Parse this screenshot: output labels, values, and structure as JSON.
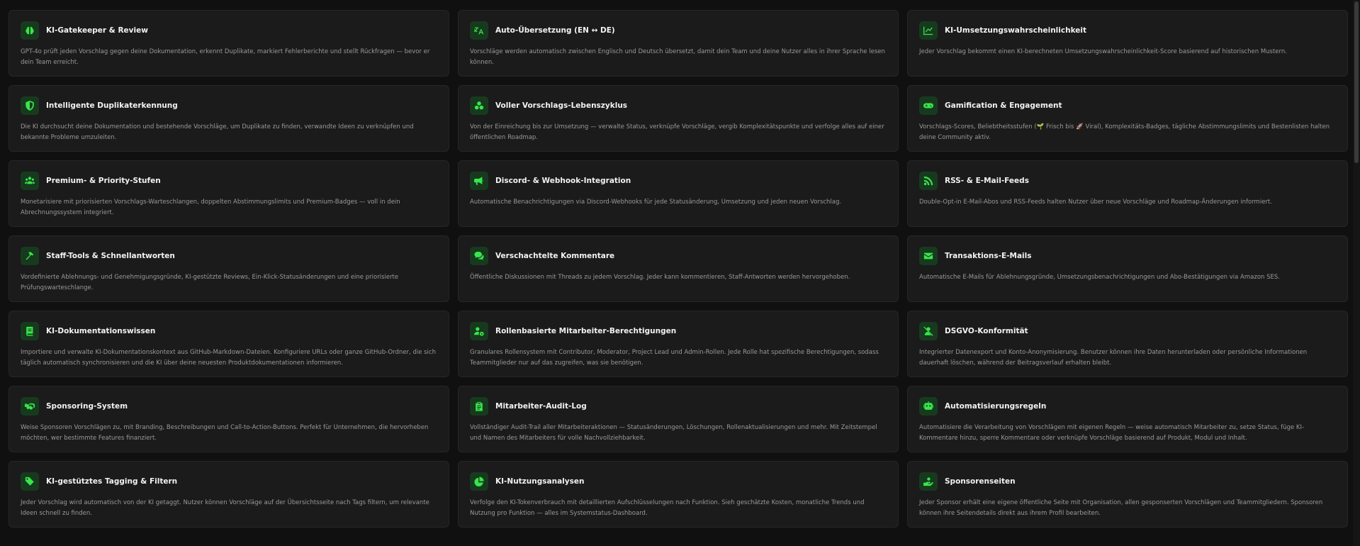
{
  "accent_color": "#38e64a",
  "cards": [
    {
      "icon": "brain-icon",
      "title": "KI-Gatekeeper & Review",
      "desc": "GPT-4o prüft jeden Vorschlag gegen deine Dokumentation, erkennt Duplikate, markiert Fehlerberichte und stellt Rückfragen — bevor er dein Team erreicht."
    },
    {
      "icon": "translate-icon",
      "title": "Auto-Übersetzung (EN ↔ DE)",
      "desc": "Vorschläge werden automatisch zwischen Englisch und Deutsch übersetzt, damit dein Team und deine Nutzer alles in ihrer Sprache lesen können."
    },
    {
      "icon": "trend-chart-icon",
      "title": "KI-Umsetzungswahrscheinlichkeit",
      "desc": "Jeder Vorschlag bekommt einen KI-berechneten Umsetzungswahrscheinlichkeit-Score basierend auf historischen Mustern."
    },
    {
      "icon": "shield-icon",
      "title": "Intelligente Duplikaterkennung",
      "desc": "Die KI durchsucht deine Dokumentation und bestehende Vorschläge, um Duplikate zu finden, verwandte Ideen zu verknüpfen und bekannte Probleme umzuleiten."
    },
    {
      "icon": "lifecycle-icon",
      "title": "Voller Vorschlags-Lebenszyklus",
      "desc": "Von der Einreichung bis zur Umsetzung — verwalte Status, verknüpfe Vorschläge, vergib Komplexitätspunkte und verfolge alles auf einer öffentlichen Roadmap."
    },
    {
      "icon": "gamepad-icon",
      "title": "Gamification & Engagement",
      "desc": "Vorschlags-Scores, Beliebtheitsstufen (🌱 Frisch bis 🚀 Viral), Komplexitäts-Badges, tägliche Abstimmungslimits und Bestenlisten halten deine Community aktiv."
    },
    {
      "icon": "users-icon",
      "title": "Premium- & Priority-Stufen",
      "desc": "Monetarisiere mit priorisierten Vorschlags-Warteschlangen, doppelten Abstimmungslimits und Premium-Badges — voll in dein Abrechnungssystem integriert."
    },
    {
      "icon": "megaphone-icon",
      "title": "Discord- & Webhook-Integration",
      "desc": "Automatische Benachrichtigungen via Discord-Webhooks für jede Statusänderung, Umsetzung und jeden neuen Vorschlag."
    },
    {
      "icon": "rss-icon",
      "title": "RSS- & E-Mail-Feeds",
      "desc": "Double-Opt-in E-Mail-Abos und RSS-Feeds halten Nutzer über neue Vorschläge und Roadmap-Änderungen informiert."
    },
    {
      "icon": "hammer-icon",
      "title": "Staff-Tools & Schnellantworten",
      "desc": "Vordefinierte Ablehnungs- und Genehmigungsgründe, KI-gestützte Reviews, Ein-Klick-Statusänderungen und eine priorisierte Prüfungswarteschlange."
    },
    {
      "icon": "comments-icon",
      "title": "Verschachtelte Kommentare",
      "desc": "Öffentliche Diskussionen mit Threads zu jedem Vorschlag. Jeder kann kommentieren, Staff-Antworten werden hervorgehoben."
    },
    {
      "icon": "envelope-icon",
      "title": "Transaktions-E-Mails",
      "desc": "Automatische E-Mails für Ablehnungsgründe, Umsetzungsbenachrichtigungen und Abo-Bestätigungen via Amazon SES."
    },
    {
      "icon": "book-icon",
      "title": "KI-Dokumentationswissen",
      "desc": "Importiere und verwalte KI-Dokumentationskontext aus GitHub-Markdown-Dateien. Konfiguriere URLs oder ganze GitHub-Ordner, die sich täglich automatisch synchronisieren und die KI über deine neuesten Produktdokumentationen informieren."
    },
    {
      "icon": "user-gear-icon",
      "title": "Rollenbasierte Mitarbeiter-Berechtigungen",
      "desc": "Granulares Rollensystem mit Contributor, Moderator, Project Lead und Admin-Rollen. Jede Rolle hat spezifische Berechtigungen, sodass Teammitglieder nur auf das zugreifen, was sie benötigen."
    },
    {
      "icon": "user-slash-icon",
      "title": "DSGVO-Konformität",
      "desc": "Integrierter Datenexport und Konto-Anonymisierung. Benutzer können ihre Daten herunterladen oder persönliche Informationen dauerhaft löschen, während der Beitragsverlauf erhalten bleibt."
    },
    {
      "icon": "handshake-icon",
      "title": "Sponsoring-System",
      "desc": "Weise Sponsoren Vorschlägen zu, mit Branding, Beschreibungen und Call-to-Action-Buttons. Perfekt für Unternehmen, die hervorheben möchten, wer bestimmte Features finanziert."
    },
    {
      "icon": "clipboard-icon",
      "title": "Mitarbeiter-Audit-Log",
      "desc": "Vollständiger Audit-Trail aller Mitarbeiteraktionen — Statusänderungen, Löschungen, Rollenaktualisierungen und mehr. Mit Zeitstempel und Namen des Mitarbeiters für volle Nachvollziehbarkeit."
    },
    {
      "icon": "robot-icon",
      "title": "Automatisierungsregeln",
      "desc": "Automatisiere die Verarbeitung von Vorschlägen mit eigenen Regeln — weise automatisch Mitarbeiter zu, setze Status, füge KI-Kommentare hinzu, sperre Kommentare oder verknüpfe Vorschläge basierend auf Produkt, Modul und Inhalt."
    },
    {
      "icon": "tags-icon",
      "title": "KI-gestütztes Tagging & Filtern",
      "desc": "Jeder Vorschlag wird automatisch von der KI getaggt. Nutzer können Vorschläge auf der Übersichtsseite nach Tags filtern, um relevante Ideen schnell zu finden."
    },
    {
      "icon": "pie-chart-icon",
      "title": "KI-Nutzungsanalysen",
      "desc": "Verfolge den KI-Tokenverbrauch mit detaillierten Aufschlüsselungen nach Funktion. Sieh geschätzte Kosten, monatliche Trends und Nutzung pro Funktion — alles im Systemstatus-Dashboard."
    },
    {
      "icon": "hand-holding-icon",
      "title": "Sponsorenseiten",
      "desc": "Jeder Sponsor erhält eine eigene öffentliche Seite mit Organisation, allen gesponserten Vorschlägen und Teammitgliedern. Sponsoren können ihre Seitendetails direkt aus ihrem Profil bearbeiten."
    }
  ]
}
